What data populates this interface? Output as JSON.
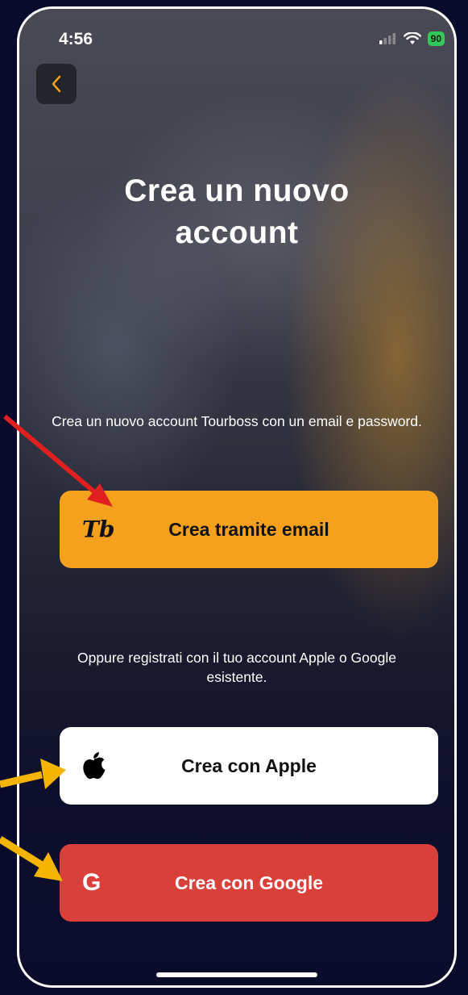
{
  "status_bar": {
    "time": "4:56",
    "battery": "90"
  },
  "header": {
    "title_line1": "Crea un nuovo",
    "title_line2": "account"
  },
  "email_section": {
    "description": "Crea un nuovo account Tourboss con un email e password.",
    "button_label": "Crea tramite email",
    "logo_text": "Tb"
  },
  "social_section": {
    "description": "Oppure registrati con il tuo account Apple o Google esistente.",
    "apple_label": "Crea con Apple",
    "google_label": "Crea con Google",
    "google_logo_text": "G"
  },
  "colors": {
    "accent": "#f6a11e",
    "google": "#d9403a",
    "apple_bg": "#ffffff",
    "arrow_red": "#e02020",
    "arrow_yellow": "#f4b400"
  },
  "icons": [
    "chevron-left-icon",
    "signal-icon",
    "wifi-icon",
    "battery-icon",
    "tourboss-logo-icon",
    "apple-icon",
    "google-icon"
  ]
}
